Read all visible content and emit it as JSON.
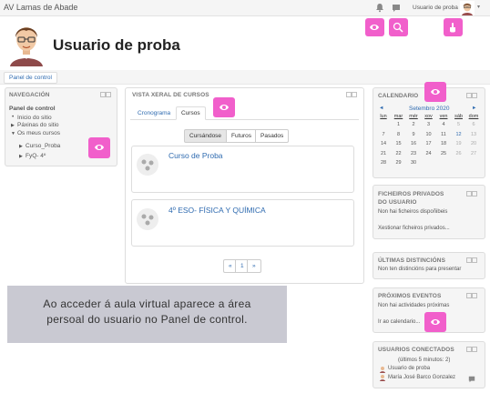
{
  "topbar": {
    "site_name": "AV Lamas de Abade",
    "user_name": "Usuario de proba",
    "caret": "▾"
  },
  "header": {
    "title": "Usuario de proba"
  },
  "breadcrumb": {
    "label": "Panel de control"
  },
  "navigation": {
    "title": "NAVEGACIÓN",
    "items": [
      "Panel de control",
      "Inicio do sitio",
      "Páxinas do sitio",
      "Os meus cursos",
      "Curso_Proba",
      "FyQ- 4º"
    ]
  },
  "courses_overview": {
    "title": "VISTA XERAL DE CURSOS",
    "tabs": [
      "Cronograma",
      "Cursos"
    ],
    "filters": [
      "Cursándose",
      "Futuros",
      "Pasados"
    ],
    "courses": [
      "Curso de Proba",
      "4º ESO- FÍSICA Y QUÍMICA"
    ],
    "pagination": {
      "prev": "«",
      "page": "1",
      "next": "»"
    }
  },
  "calendar": {
    "title": "CALENDARIO",
    "month": "Setembro 2020",
    "prev": "◄",
    "next": "►",
    "weekdays": [
      "lun",
      "mar",
      "mér",
      "xov",
      "ven",
      "sáb",
      "dom"
    ],
    "weeks": [
      [
        "",
        "1",
        "2",
        "3",
        "4",
        "5",
        "6"
      ],
      [
        "7",
        "8",
        "9",
        "10",
        "11",
        "12",
        "13"
      ],
      [
        "14",
        "15",
        "16",
        "17",
        "18",
        "19",
        "20"
      ],
      [
        "21",
        "22",
        "23",
        "24",
        "25",
        "26",
        "27"
      ],
      [
        "28",
        "29",
        "30",
        "",
        "",
        "",
        ""
      ]
    ],
    "highlight_day": "12"
  },
  "private_files": {
    "title_line1": "FICHEIROS PRIVADOS",
    "title_line2": "DO USUARIO",
    "empty": "Non hai ficheiros dispoñibeis",
    "manage_link": "Xestionar ficheiros privados..."
  },
  "badges": {
    "title": "ÚLTIMAS DISTINCIÓNS",
    "empty": "Non ten distincións para presentar"
  },
  "events": {
    "title": "PRÓXIMOS EVENTOS",
    "empty": "Non hai actividades próximas",
    "calendar_link": "Ir ao calendario..."
  },
  "online_users": {
    "title": "USUARIOS CONECTADOS",
    "note": "(últimos 5 minutos: 2)",
    "users": [
      "Usuario de proba",
      "María José Barco Gonzalez"
    ]
  },
  "caption": {
    "line1": "Ao acceder á aula virtual aparece a área",
    "line2": "persoal do usuario no Panel de control."
  },
  "colors": {
    "accent_pink": "#f15fcb",
    "link_blue": "#2f6bb0",
    "caption_bg": "#c9c9d2"
  },
  "icons": [
    "eye-icon",
    "search-icon",
    "hand-pointer-icon",
    "bell-icon",
    "chat-icon"
  ]
}
